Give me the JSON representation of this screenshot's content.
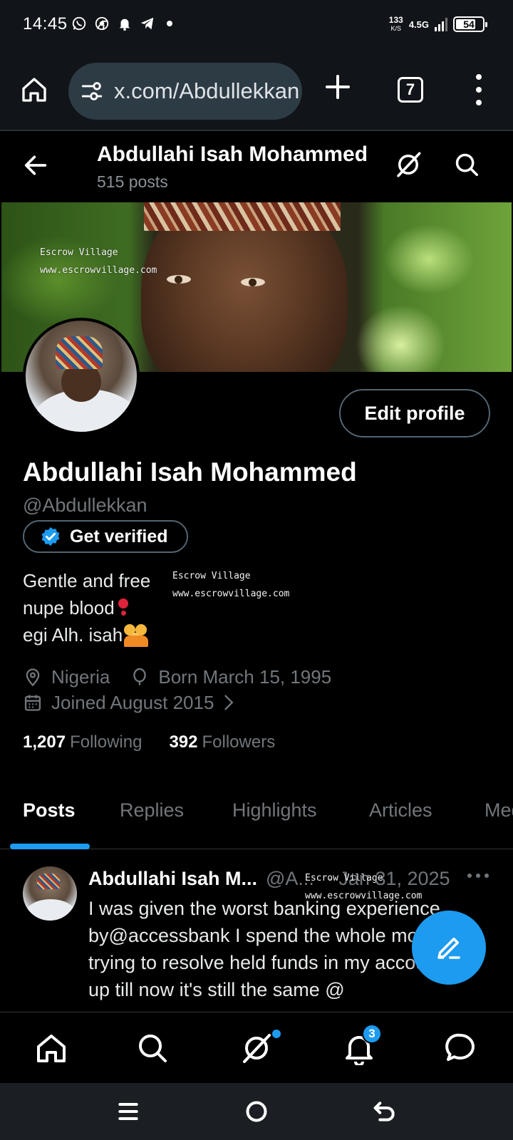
{
  "status_bar": {
    "time": "14:45",
    "speed_value": "133",
    "speed_unit": "K/S",
    "network": "4.5G",
    "battery": "54",
    "notification_icons": [
      "whatsapp-icon",
      "chrome-icon",
      "bell-icon",
      "telegram-icon"
    ]
  },
  "browser": {
    "url": "x.com/Abdullekkan",
    "tab_count": "7"
  },
  "profile_header": {
    "name": "Abdullahi Isah Mohammed",
    "posts_count": "515 posts"
  },
  "watermark": {
    "line1": "Escrow Village",
    "line2": "www.escrowvillage.com"
  },
  "profile": {
    "edit_label": "Edit profile",
    "name": "Abdullahi Isah Mohammed",
    "handle": "@Abdullekkan",
    "verify_label": "Get verified",
    "bio_line1": "Gentle and free",
    "bio_line2": "nupe blood",
    "bio_line3": "egi Alh. isah",
    "location": "Nigeria",
    "birthday": "Born March 15, 1995",
    "joined": "Joined August 2015",
    "following_count": "1,207",
    "following_label": "Following",
    "followers_count": "392",
    "followers_label": "Followers"
  },
  "tabs": [
    {
      "label": "Posts",
      "active": true
    },
    {
      "label": "Replies",
      "active": false
    },
    {
      "label": "Highlights",
      "active": false
    },
    {
      "label": "Articles",
      "active": false
    },
    {
      "label": "Media",
      "active": false
    }
  ],
  "post": {
    "author": "Abdullahi Isah M...",
    "handle": "@A...",
    "date": "· Jan 31, 2025",
    "text": "I was given the worst banking experience by@accessbank I spend the whole morning trying to resolve held funds in my account but up till now it's still the same @"
  },
  "bottom_nav": {
    "notifications_badge": "3",
    "items": [
      "home-icon",
      "search-icon",
      "grok-icon",
      "notifications-icon",
      "messages-icon"
    ]
  },
  "colors": {
    "accent": "#1d9bf0",
    "background": "#000000",
    "muted_text": "#71767b",
    "browser_bar": "#111418"
  }
}
